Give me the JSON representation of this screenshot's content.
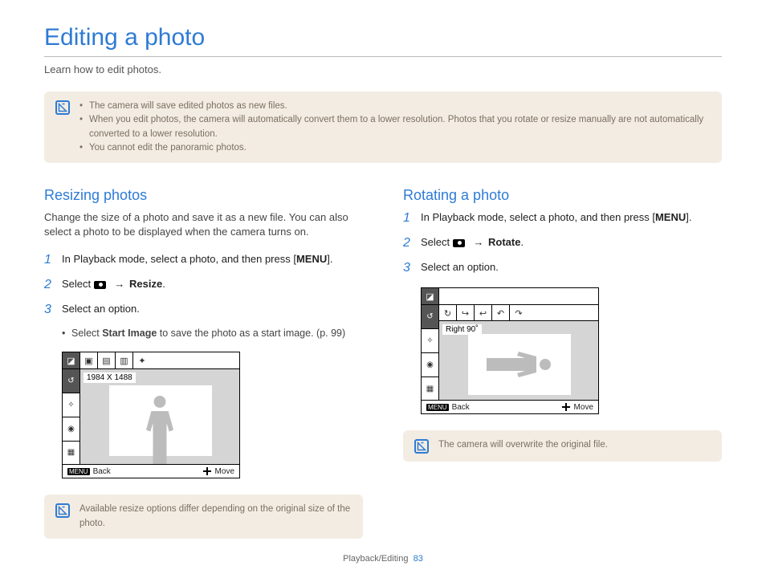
{
  "page": {
    "title": "Editing a photo",
    "intro": "Learn how to edit photos.",
    "chapter": "Playback/Editing",
    "page_number": "83"
  },
  "top_callout": {
    "items": [
      "The camera will save edited photos as new files.",
      "When you edit photos, the camera will automatically convert them to a lower resolution. Photos that you rotate or resize manually are not automatically converted to a lower resolution.",
      "You cannot edit the panoramic photos."
    ]
  },
  "resizing": {
    "title": "Resizing photos",
    "intro": "Change the size of a photo and save it as a new file. You can also select a photo to be displayed when the camera turns on.",
    "steps": {
      "s1_a": "In Playback mode, select a photo, and then press [",
      "menu": "MENU",
      "s1_b": "].",
      "s2_a": "Select ",
      "s2_arrow": " → ",
      "s2_b": "Resize",
      "s2_c": ".",
      "s3": "Select an option."
    },
    "sub_a": "Select ",
    "sub_b": "Start Image",
    "sub_c": " to save the photo as a start image. (p. 99)",
    "screen": {
      "tooltip": "1984 X 1488",
      "back": "Back",
      "move": "Move"
    },
    "callout": "Available resize options differ depending on the original size of the photo."
  },
  "rotating": {
    "title": "Rotating a photo",
    "steps": {
      "s1_a": "In Playback mode, select a photo, and then press [",
      "menu": "MENU",
      "s1_b": "].",
      "s2_a": "Select ",
      "s2_arrow": " → ",
      "s2_b": "Rotate",
      "s2_c": ".",
      "s3": "Select an option."
    },
    "screen": {
      "tooltip": "Right 90˚",
      "back": "Back",
      "move": "Move"
    },
    "callout": "The camera will overwrite the original file."
  }
}
